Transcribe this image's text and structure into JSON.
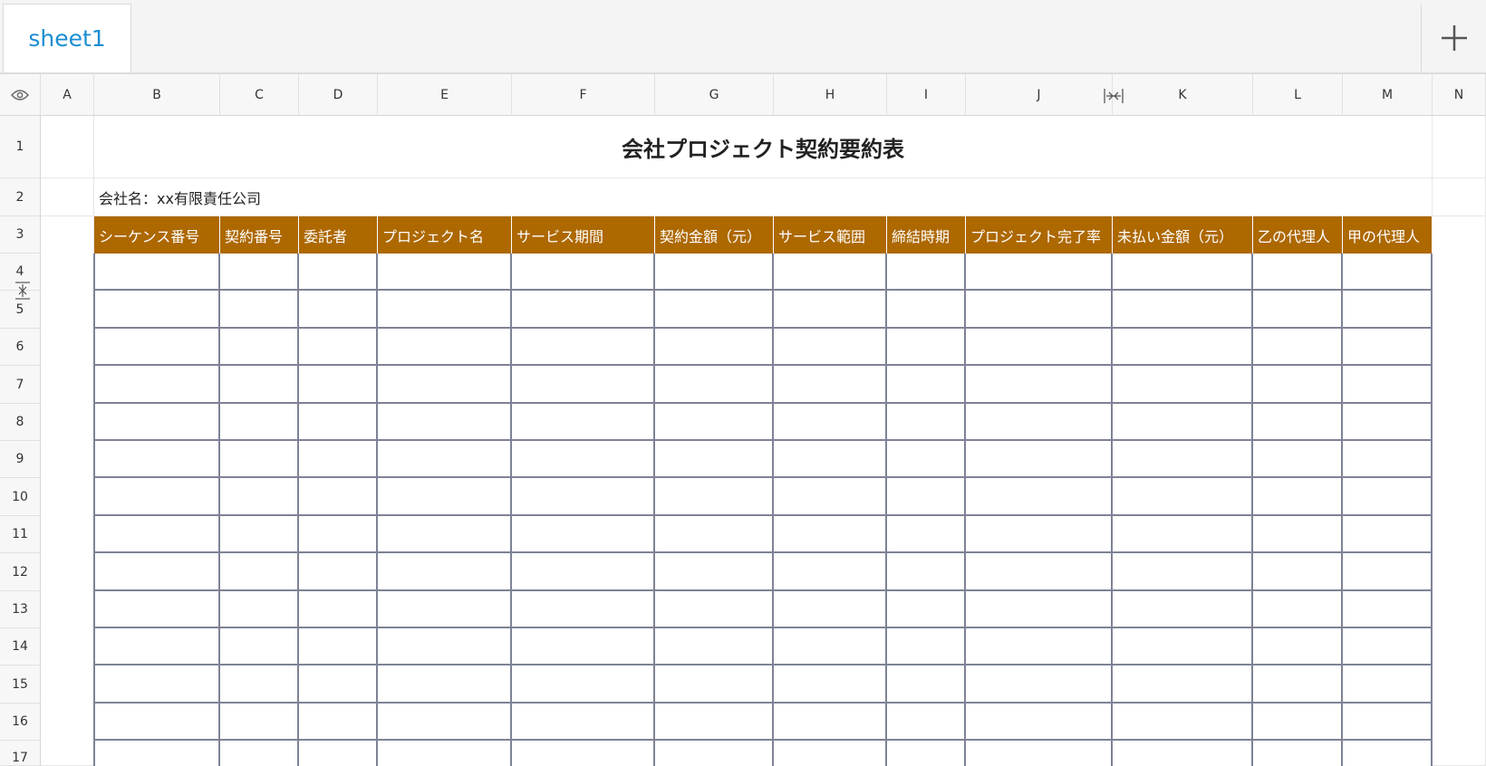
{
  "sheet_tabs": [
    {
      "label": "sheet1",
      "active": true
    }
  ],
  "add_sheet_icon": "plus-icon",
  "columns": [
    "A",
    "B",
    "C",
    "D",
    "E",
    "F",
    "G",
    "H",
    "I",
    "J",
    "K",
    "L",
    "M",
    "N"
  ],
  "rows": [
    "1",
    "2",
    "3",
    "4",
    "5",
    "6",
    "7",
    "8",
    "9",
    "10",
    "11",
    "12",
    "13",
    "14",
    "15",
    "16",
    "17"
  ],
  "title": "会社プロジェクト契約要約表",
  "company_line": "会社名：xx有限責任公司",
  "table_headers": [
    "シーケンス番号",
    "契約番号",
    "委託者",
    "プロジェクト名",
    "サービス期間",
    "契約金額（元）",
    "サービス範囲",
    "締結時期",
    "プロジェクト完了率",
    "未払い金額（元）",
    "乙の代理人",
    "甲の代理人"
  ],
  "colors": {
    "header_fill": "#ad6800",
    "tab_text": "#1a8ed1",
    "table_border": "#7d8296"
  }
}
